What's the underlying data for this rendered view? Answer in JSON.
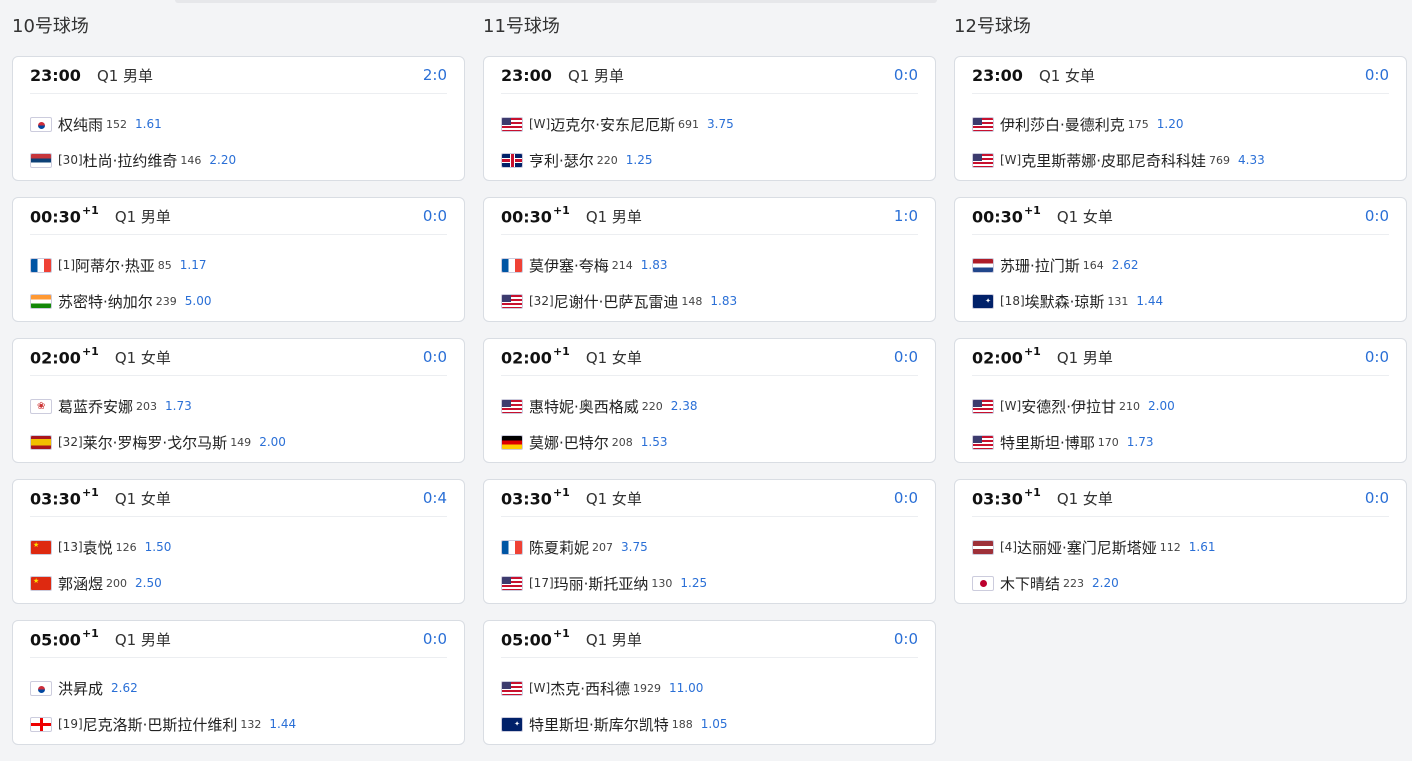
{
  "courts": [
    {
      "title": "10号球场",
      "matches": [
        {
          "time": "23:00",
          "day": "",
          "round": "Q1 男单",
          "score": "2:0",
          "players": [
            {
              "flag": "kr-flag-icon",
              "seed": "",
              "name": "权纯雨",
              "rank": "152",
              "odds": "1.61"
            },
            {
              "flag": "rs-flag-icon",
              "seed": "[30]",
              "name": "杜尚·拉约维奇",
              "rank": "146",
              "odds": "2.20"
            }
          ]
        },
        {
          "time": "00:30",
          "day": "+1",
          "round": "Q1 男单",
          "score": "0:0",
          "players": [
            {
              "flag": "fr-flag-icon",
              "seed": "[1]",
              "name": "阿蒂尔·热亚",
              "rank": "85",
              "odds": "1.17"
            },
            {
              "flag": "in-flag-icon",
              "seed": "",
              "name": "苏密特·纳加尔",
              "rank": "239",
              "odds": "5.00"
            }
          ]
        },
        {
          "time": "02:00",
          "day": "+1",
          "round": "Q1 女单",
          "score": "0:0",
          "players": [
            {
              "flag": "tw-flag-icon",
              "seed": "",
              "name": "葛蓝乔安娜",
              "rank": "203",
              "odds": "1.73"
            },
            {
              "flag": "es-flag-icon",
              "seed": "[32]",
              "name": "莱尔·罗梅罗·戈尔马斯",
              "rank": "149",
              "odds": "2.00"
            }
          ]
        },
        {
          "time": "03:30",
          "day": "+1",
          "round": "Q1 女单",
          "score": "0:4",
          "players": [
            {
              "flag": "cn-flag-icon",
              "seed": "[13]",
              "name": "袁悦",
              "rank": "126",
              "odds": "1.50"
            },
            {
              "flag": "cn-flag-icon",
              "seed": "",
              "name": "郭涵煜",
              "rank": "200",
              "odds": "2.50"
            }
          ]
        },
        {
          "time": "05:00",
          "day": "+1",
          "round": "Q1 男单",
          "score": "0:0",
          "players": [
            {
              "flag": "kr-flag-icon",
              "seed": "",
              "name": "洪昇成",
              "rank": "",
              "odds": "2.62"
            },
            {
              "flag": "ge-flag-icon",
              "seed": "[19]",
              "name": "尼克洛斯·巴斯拉什维利",
              "rank": "132",
              "odds": "1.44"
            }
          ]
        }
      ]
    },
    {
      "title": "11号球场",
      "matches": [
        {
          "time": "23:00",
          "day": "",
          "round": "Q1 男单",
          "score": "0:0",
          "players": [
            {
              "flag": "us-flag-icon",
              "seed": "[W]",
              "name": "迈克尔·安东尼厄斯",
              "rank": "691",
              "odds": "3.75"
            },
            {
              "flag": "gb-flag-icon",
              "seed": "",
              "name": "亨利·瑟尔",
              "rank": "220",
              "odds": "1.25"
            }
          ]
        },
        {
          "time": "00:30",
          "day": "+1",
          "round": "Q1 男单",
          "score": "1:0",
          "players": [
            {
              "flag": "fr-flag-icon",
              "seed": "",
              "name": "莫伊塞·夸梅",
              "rank": "214",
              "odds": "1.83"
            },
            {
              "flag": "us-flag-icon",
              "seed": "[32]",
              "name": "尼谢什·巴萨瓦雷迪",
              "rank": "148",
              "odds": "1.83"
            }
          ]
        },
        {
          "time": "02:00",
          "day": "+1",
          "round": "Q1 女单",
          "score": "0:0",
          "players": [
            {
              "flag": "us-flag-icon",
              "seed": "",
              "name": "惠特妮·奥西格威",
              "rank": "220",
              "odds": "2.38"
            },
            {
              "flag": "de-flag-icon",
              "seed": "",
              "name": "莫娜·巴特尔",
              "rank": "208",
              "odds": "1.53"
            }
          ]
        },
        {
          "time": "03:30",
          "day": "+1",
          "round": "Q1 女单",
          "score": "0:0",
          "players": [
            {
              "flag": "fr-flag-icon",
              "seed": "",
              "name": "陈夏莉妮",
              "rank": "207",
              "odds": "3.75"
            },
            {
              "flag": "us-flag-icon",
              "seed": "[17]",
              "name": "玛丽·斯托亚纳",
              "rank": "130",
              "odds": "1.25"
            }
          ]
        },
        {
          "time": "05:00",
          "day": "+1",
          "round": "Q1 男单",
          "score": "0:0",
          "players": [
            {
              "flag": "us-flag-icon",
              "seed": "[W]",
              "name": "杰克·西科德",
              "rank": "1929",
              "odds": "11.00"
            },
            {
              "flag": "au-flag-icon",
              "seed": "",
              "name": "特里斯坦·斯库尔凯特",
              "rank": "188",
              "odds": "1.05"
            }
          ]
        }
      ]
    },
    {
      "title": "12号球场",
      "matches": [
        {
          "time": "23:00",
          "day": "",
          "round": "Q1 女单",
          "score": "0:0",
          "players": [
            {
              "flag": "us-flag-icon",
              "seed": "",
              "name": "伊利莎白·曼德利克",
              "rank": "175",
              "odds": "1.20"
            },
            {
              "flag": "us-flag-icon",
              "seed": "[W]",
              "name": "克里斯蒂娜·皮耶尼奇科科娃",
              "rank": "769",
              "odds": "4.33"
            }
          ]
        },
        {
          "time": "00:30",
          "day": "+1",
          "round": "Q1 女单",
          "score": "0:0",
          "players": [
            {
              "flag": "nl-flag-icon",
              "seed": "",
              "name": "苏珊·拉门斯",
              "rank": "164",
              "odds": "2.62"
            },
            {
              "flag": "au-flag-icon",
              "seed": "[18]",
              "name": "埃默森·琼斯",
              "rank": "131",
              "odds": "1.44"
            }
          ]
        },
        {
          "time": "02:00",
          "day": "+1",
          "round": "Q1 男单",
          "score": "0:0",
          "players": [
            {
              "flag": "us-flag-icon",
              "seed": "[W]",
              "name": "安德烈·伊拉甘",
              "rank": "210",
              "odds": "2.00"
            },
            {
              "flag": "us-flag-icon",
              "seed": "",
              "name": "特里斯坦·博耶",
              "rank": "170",
              "odds": "1.73"
            }
          ]
        },
        {
          "time": "03:30",
          "day": "+1",
          "round": "Q1 女单",
          "score": "0:0",
          "players": [
            {
              "flag": "lv-flag-icon",
              "seed": "[4]",
              "name": "达丽娅·塞门尼斯塔娅",
              "rank": "112",
              "odds": "1.61"
            },
            {
              "flag": "jp-flag-icon",
              "seed": "",
              "name": "木下晴结",
              "rank": "223",
              "odds": "2.20"
            }
          ]
        }
      ]
    }
  ]
}
